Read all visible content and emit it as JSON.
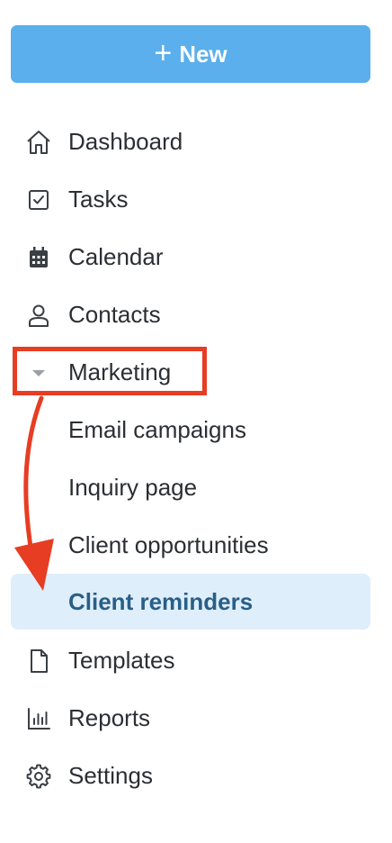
{
  "new_button": {
    "label": "New",
    "plus": "+"
  },
  "nav": {
    "dashboard": "Dashboard",
    "tasks": "Tasks",
    "calendar": "Calendar",
    "contacts": "Contacts",
    "marketing": "Marketing",
    "email_campaigns": "Email campaigns",
    "inquiry_page": "Inquiry page",
    "client_opportunities": "Client opportunities",
    "client_reminders": "Client reminders",
    "templates": "Templates",
    "reports": "Reports",
    "settings": "Settings"
  },
  "icons": {
    "dashboard": "home-icon",
    "tasks": "checkbox-icon",
    "calendar": "calendar-icon",
    "contacts": "user-icon",
    "marketing": "caret-down-icon",
    "templates": "document-icon",
    "reports": "bar-chart-icon",
    "settings": "gear-icon"
  },
  "colors": {
    "primary": "#5aafec",
    "active_bg": "#dfeefb",
    "active_text": "#295f88",
    "annotation": "#e63d23"
  }
}
